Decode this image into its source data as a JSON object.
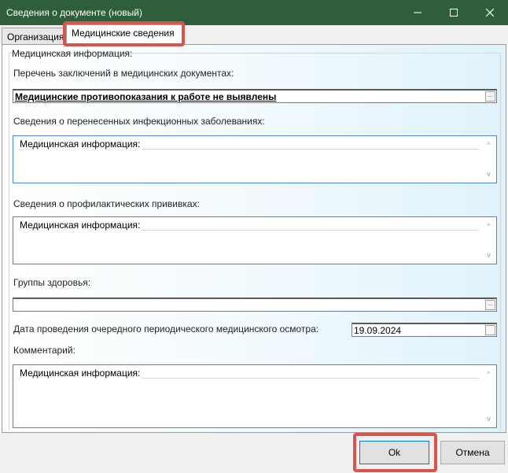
{
  "window": {
    "title": "Сведения о документе (новый)"
  },
  "tabs": [
    {
      "label": "Организация"
    },
    {
      "label": "Медицинские сведения"
    }
  ],
  "group": {
    "legend": "Медицинская информация:"
  },
  "fields": {
    "conclusions_label": "Перечень заключений в медицинских документах:",
    "conclusions_value": "Медицинские противопоказания к работе не выявлены",
    "infections_label": "Сведения о перенесенных инфекционных заболеваниях:",
    "infections_inner": "Медицинская информация:",
    "vaccinations_label": "Сведения о профилактических прививках:",
    "vaccinations_inner": "Медицинская информация:",
    "health_groups_label": "Группы здоровья:",
    "health_groups_value": "",
    "exam_date_label": "Дата проведения очередного периодического медицинского осмотра:",
    "exam_date_value": "19.09.2024",
    "comment_label": "Комментарий:",
    "comment_inner": "Медицинская информация:"
  },
  "buttons": {
    "ok": "Ok",
    "cancel": "Отмена"
  },
  "glyphs": {
    "ellipsis": "...",
    "scroll_up": "^",
    "scroll_down": "v"
  },
  "colors": {
    "titlebar": "#2e5e3a",
    "highlight": "#d9534f",
    "focus_border": "#4a86c8"
  }
}
